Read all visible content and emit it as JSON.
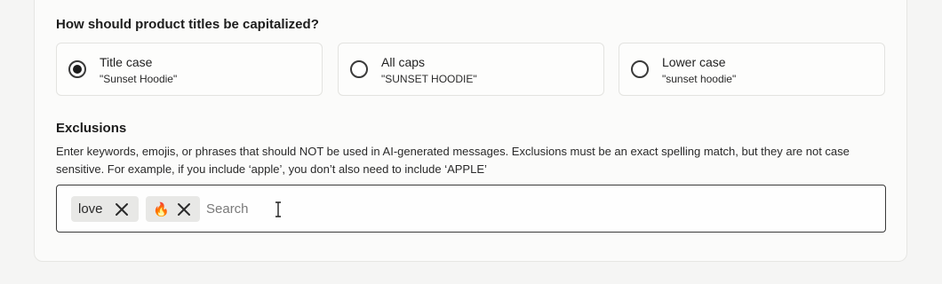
{
  "capitalization": {
    "title": "How should product titles be capitalized?",
    "options": [
      {
        "label": "Title case",
        "example": "\"Sunset Hoodie\"",
        "selected": true
      },
      {
        "label": "All caps",
        "example": "\"SUNSET HOODIE\"",
        "selected": false
      },
      {
        "label": "Lower case",
        "example": "\"sunset hoodie\"",
        "selected": false
      }
    ]
  },
  "exclusions": {
    "title": "Exclusions",
    "description": "Enter keywords, emojis, or phrases that should NOT be used in AI-generated messages. Exclusions must be an exact spelling match, but they are not case sensitive. For example, if you include ‘apple’, you don’t also need to include ‘APPLE’",
    "tags": [
      {
        "text": "love",
        "remove_icon": "close-icon"
      },
      {
        "text": "🔥",
        "remove_icon": "close-icon"
      }
    ],
    "search_placeholder": "Search"
  }
}
